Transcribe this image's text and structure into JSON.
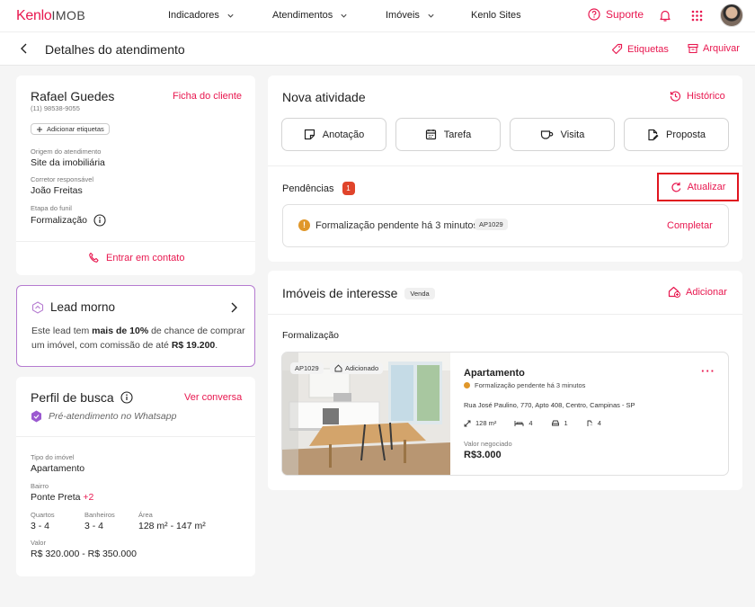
{
  "colors": {
    "accent": "#e8174f",
    "lead_border": "#b57bd0",
    "pending_dot": "#e0972a"
  },
  "nav": {
    "logo_main": "Kenlo",
    "logo_sub": "IMOB",
    "items": [
      "Indicadores",
      "Atendimentos",
      "Imóveis",
      "Kenlo Sites"
    ],
    "support": "Suporte"
  },
  "subheader": {
    "title": "Detalhes do atendimento",
    "tags": "Etiquetas",
    "archive": "Arquivar"
  },
  "client": {
    "name": "Rafael Guedes",
    "phone": "(11) 98538-9055",
    "client_link": "Ficha do cliente",
    "add_tags": "Adicionar etiquetas",
    "fields": [
      {
        "label": "Origem do atendimento",
        "value": "Site da imobiliária"
      },
      {
        "label": "Corretor responsável",
        "value": "João Freitas"
      },
      {
        "label": "Etapa do funil",
        "value": "Formalização"
      }
    ],
    "contact": "Entrar em contato"
  },
  "lead": {
    "title": "Lead morno",
    "text_1": "Este lead tem ",
    "text_bold_1": "mais de 10%",
    "text_2": " de chance de comprar um imóvel, com comissão de até ",
    "text_bold_2": "R$ 19.200",
    "text_3": "."
  },
  "profile": {
    "title": "Perfil de busca",
    "link": "Ver conversa",
    "status": "Pré-atendimento no Whatsapp",
    "type_label": "Tipo do imóvel",
    "type_value": "Apartamento",
    "neighborhood_label": "Bairro",
    "neighborhood_value": "Ponte Preta",
    "neighborhood_extra": "+2",
    "rooms_label": "Quartos",
    "rooms_value": "3 - 4",
    "baths_label": "Banheiros",
    "baths_value": "3 - 4",
    "area_label": "Área",
    "area_value": "128 m² - 147 m²",
    "price_label": "Valor",
    "price_value": "R$ 320.000 - R$ 350.000"
  },
  "activity": {
    "title": "Nova atividade",
    "history": "Histórico",
    "buttons": [
      "Anotação",
      "Tarefa",
      "Visita",
      "Proposta"
    ],
    "pending_title": "Pendências",
    "pending_count": "1",
    "refresh": "Atualizar",
    "pending_text": "Formalização pendente há 3 minutos",
    "pending_code": "AP1029",
    "complete": "Completar"
  },
  "interest": {
    "title": "Imóveis de interesse",
    "tag": "Venda",
    "add": "Adicionar",
    "section": "Formalização",
    "property": {
      "code": "AP1029",
      "added": "Adicionado",
      "type": "Apartamento",
      "status": "Formalização pendente há 3 minutos",
      "address": "Rua José Paulino, 770, Apto 408, Centro, Campinas - SP",
      "area": "128 m²",
      "beds": "4",
      "parking": "1",
      "baths": "4",
      "value_label": "Valor negociado",
      "value": "R$3.000"
    }
  }
}
